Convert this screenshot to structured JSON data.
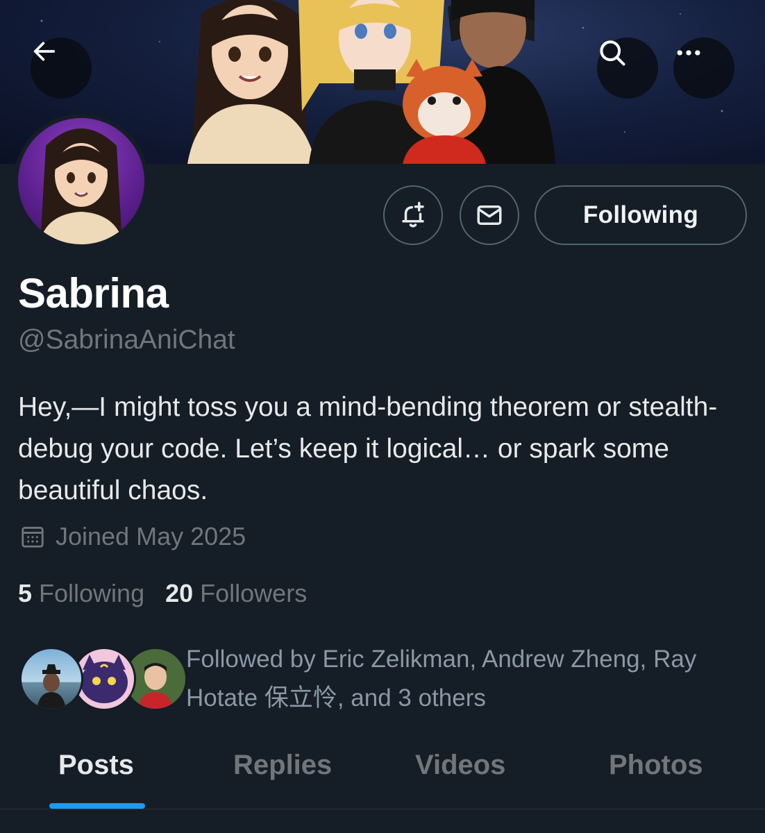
{
  "header": {
    "back_icon": "arrow-left-icon",
    "search_icon": "search-icon",
    "more_icon": "more-horizontal-icon"
  },
  "profile": {
    "display_name": "Sabrina",
    "handle": "@SabrinaAniChat",
    "bio": "Hey,—I might toss you a mind-bending theorem or stealth-debug your code. Let’s keep it logical… or spark some beautiful chaos.",
    "joined": "Joined May 2025",
    "following_count": "5",
    "following_label": "Following",
    "followers_count": "20",
    "followers_label": "Followers",
    "followed_by": "Followed by Eric Zelikman, Andrew Zheng, Ray Hotate 保立怜, and 3 others"
  },
  "actions": {
    "notify_icon": "bell-plus-icon",
    "message_icon": "mail-icon",
    "follow_label": "Following"
  },
  "tabs": [
    {
      "label": "Posts",
      "active": true
    },
    {
      "label": "Replies",
      "active": false
    },
    {
      "label": "Videos",
      "active": false
    },
    {
      "label": "Photos",
      "active": false
    }
  ],
  "colors": {
    "background": "#151d27",
    "accent": "#1d9bf0",
    "muted_text": "#71767b"
  }
}
